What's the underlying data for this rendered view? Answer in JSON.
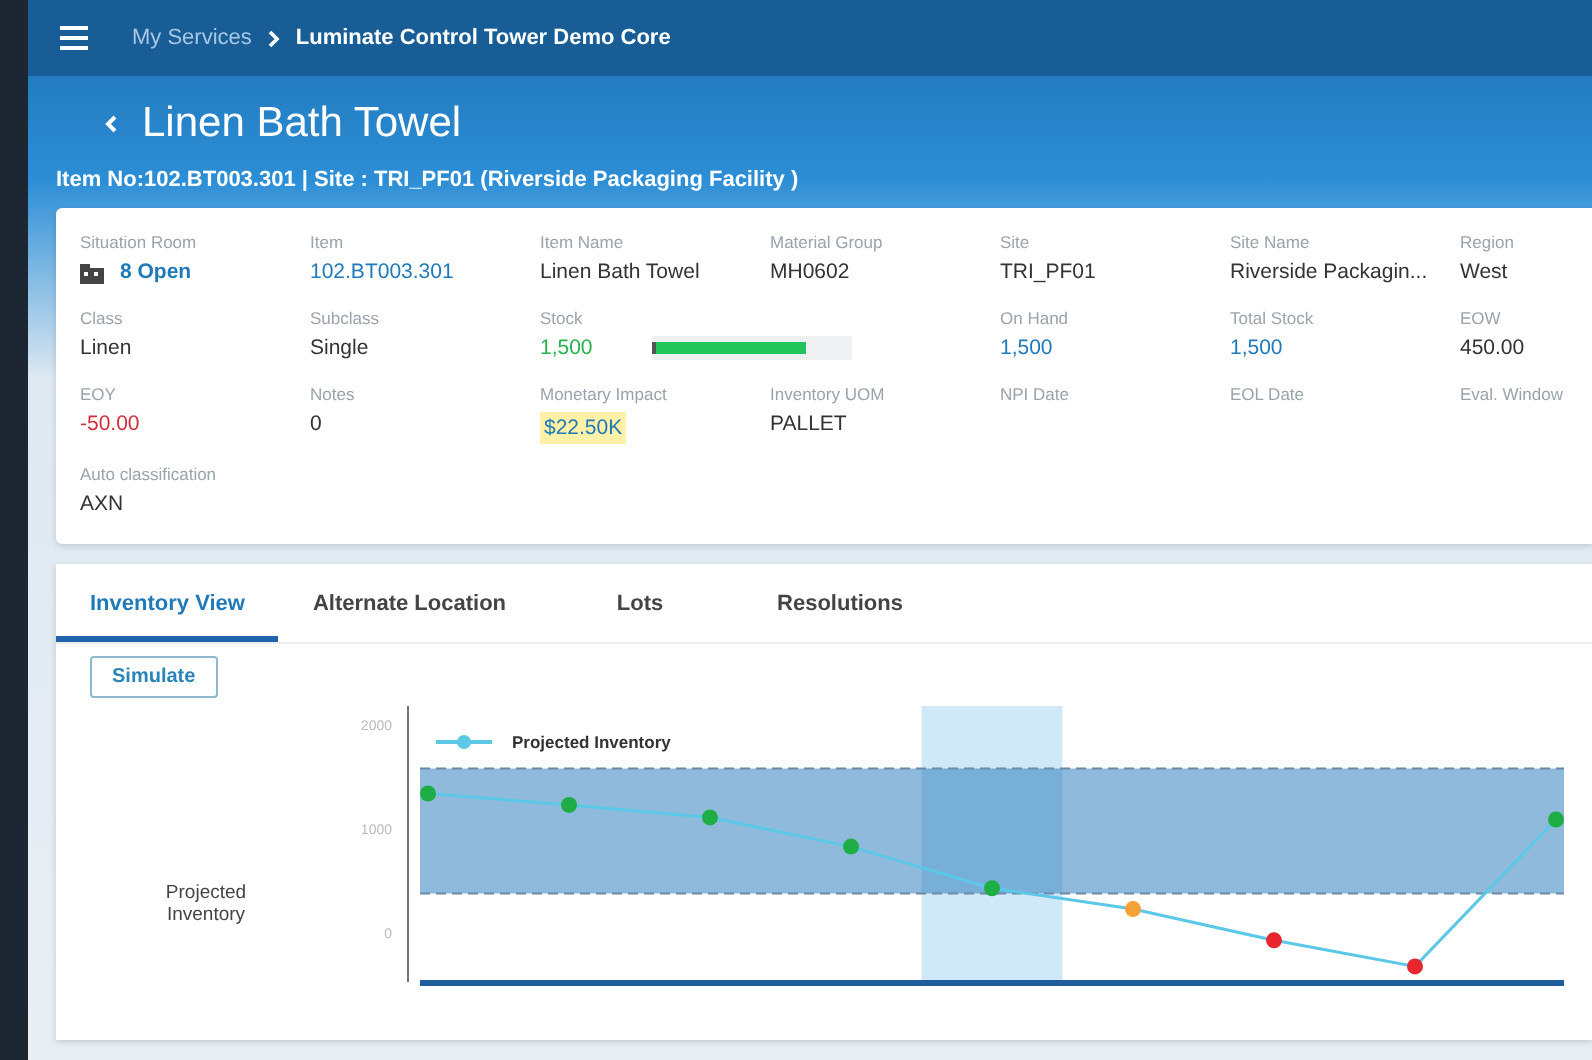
{
  "top_bar": {
    "breadcrumb": [
      {
        "label": "My Services",
        "current": false
      },
      {
        "label": "Luminate Control Tower Demo Core",
        "current": true
      }
    ]
  },
  "header": {
    "title": "Linen Bath Towel",
    "subtitle": "Item No:102.BT003.301 | Site : TRI_PF01 (Riverside Packaging Facility )"
  },
  "details": [
    {
      "label": "Situation Room",
      "value": "8 Open",
      "kind": "situation"
    },
    {
      "label": "Item",
      "value": "102.BT003.301",
      "kind": "link"
    },
    {
      "label": "Item Name",
      "value": "Linen Bath Towel",
      "kind": "plain"
    },
    {
      "label": "Material Group",
      "value": "MH0602",
      "kind": "plain"
    },
    {
      "label": "Site",
      "value": "TRI_PF01",
      "kind": "plain"
    },
    {
      "label": "Site Name",
      "value": "Riverside Packagin...",
      "kind": "plain"
    },
    {
      "label": "Region",
      "value": "West",
      "kind": "plain"
    },
    {
      "label": "Class",
      "value": "Linen",
      "kind": "plain"
    },
    {
      "label": "Subclass",
      "value": "Single",
      "kind": "plain"
    },
    {
      "label": "Stock",
      "value": "1,500",
      "kind": "stock",
      "level": 0.75
    },
    {
      "label": "On Hand",
      "value": "1,500",
      "kind": "link"
    },
    {
      "label": "Total Stock",
      "value": "1,500",
      "kind": "link"
    },
    {
      "label": "EOW",
      "value": "450.00",
      "kind": "plain"
    },
    {
      "label": "EOY",
      "value": "-50.00",
      "kind": "negative"
    },
    {
      "label": "Notes",
      "value": "0",
      "kind": "plain"
    },
    {
      "label": "Monetary Impact",
      "value": "$22.50K",
      "kind": "highlight"
    },
    {
      "label": "Inventory UOM",
      "value": "PALLET",
      "kind": "plain"
    },
    {
      "label": "NPI Date",
      "kind": "plain"
    },
    {
      "label": "EOL Date",
      "kind": "plain"
    },
    {
      "label": "Eval. Window",
      "kind": "plain"
    },
    {
      "label": "Auto classification",
      "value": "AXN",
      "kind": "plain"
    }
  ],
  "tabs": [
    {
      "label": "Inventory View",
      "selected": true
    },
    {
      "label": "Alternate Location",
      "selected": false
    },
    {
      "label": "Lots",
      "selected": false
    },
    {
      "label": "Resolutions",
      "selected": false
    }
  ],
  "simulate_button": "Simulate",
  "chart_data": {
    "type": "line",
    "yticks": [
      0,
      1000,
      2000
    ],
    "ylim": [
      -450,
      2200
    ],
    "series": [
      {
        "name": "Projected Inventory",
        "color": "#5bc8e8",
        "marker": "circle",
        "values": [
          1360,
          1250,
          1130,
          850,
          450,
          250,
          -50,
          -300,
          1110
        ]
      }
    ],
    "bands": [
      {
        "axis": "y",
        "from": 400,
        "to": 1600
      }
    ],
    "ref_lines": [
      {
        "axis": "y",
        "value": 1600
      },
      {
        "axis": "y",
        "value": 400
      }
    ],
    "annotations": [
      {
        "text": "Projected Inventory"
      }
    ]
  }
}
